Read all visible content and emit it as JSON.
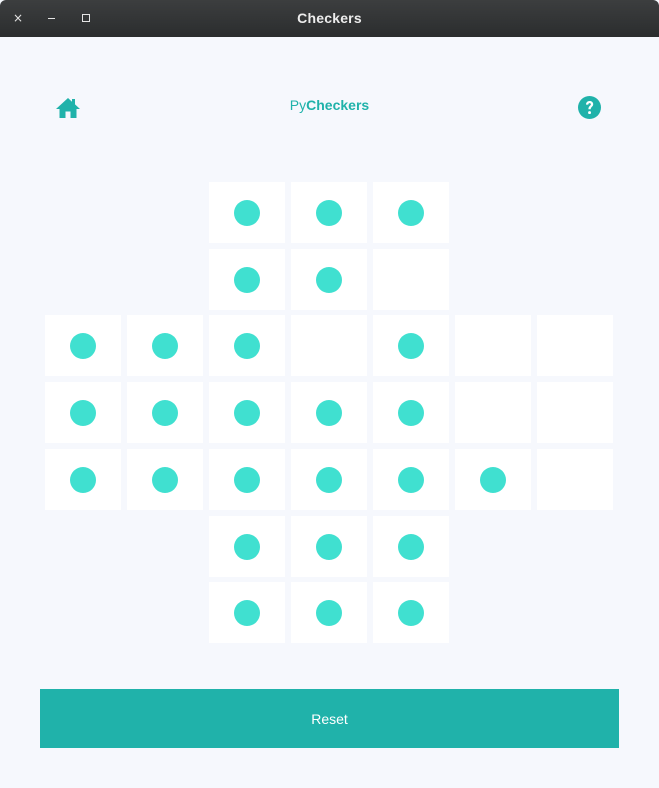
{
  "window": {
    "title": "Checkers",
    "close_glyph": "×"
  },
  "header": {
    "title_prefix": "Py",
    "title_bold": "Checkers",
    "home_icon": "home-icon",
    "help_icon": "help-icon"
  },
  "colors": {
    "accent": "#20b2aa",
    "peg": "#40e0d0",
    "cell": "#ffffff",
    "background": "#f6f8fd"
  },
  "board": {
    "rows": [
      [
        null,
        null,
        true,
        true,
        true,
        null,
        null
      ],
      [
        null,
        null,
        true,
        true,
        false,
        null,
        null
      ],
      [
        true,
        true,
        true,
        false,
        true,
        false,
        false
      ],
      [
        true,
        true,
        true,
        true,
        true,
        false,
        false
      ],
      [
        true,
        true,
        true,
        true,
        true,
        true,
        false
      ],
      [
        null,
        null,
        true,
        true,
        true,
        null,
        null
      ],
      [
        null,
        null,
        true,
        true,
        true,
        null,
        null
      ]
    ]
  },
  "controls": {
    "reset_label": "Reset"
  }
}
